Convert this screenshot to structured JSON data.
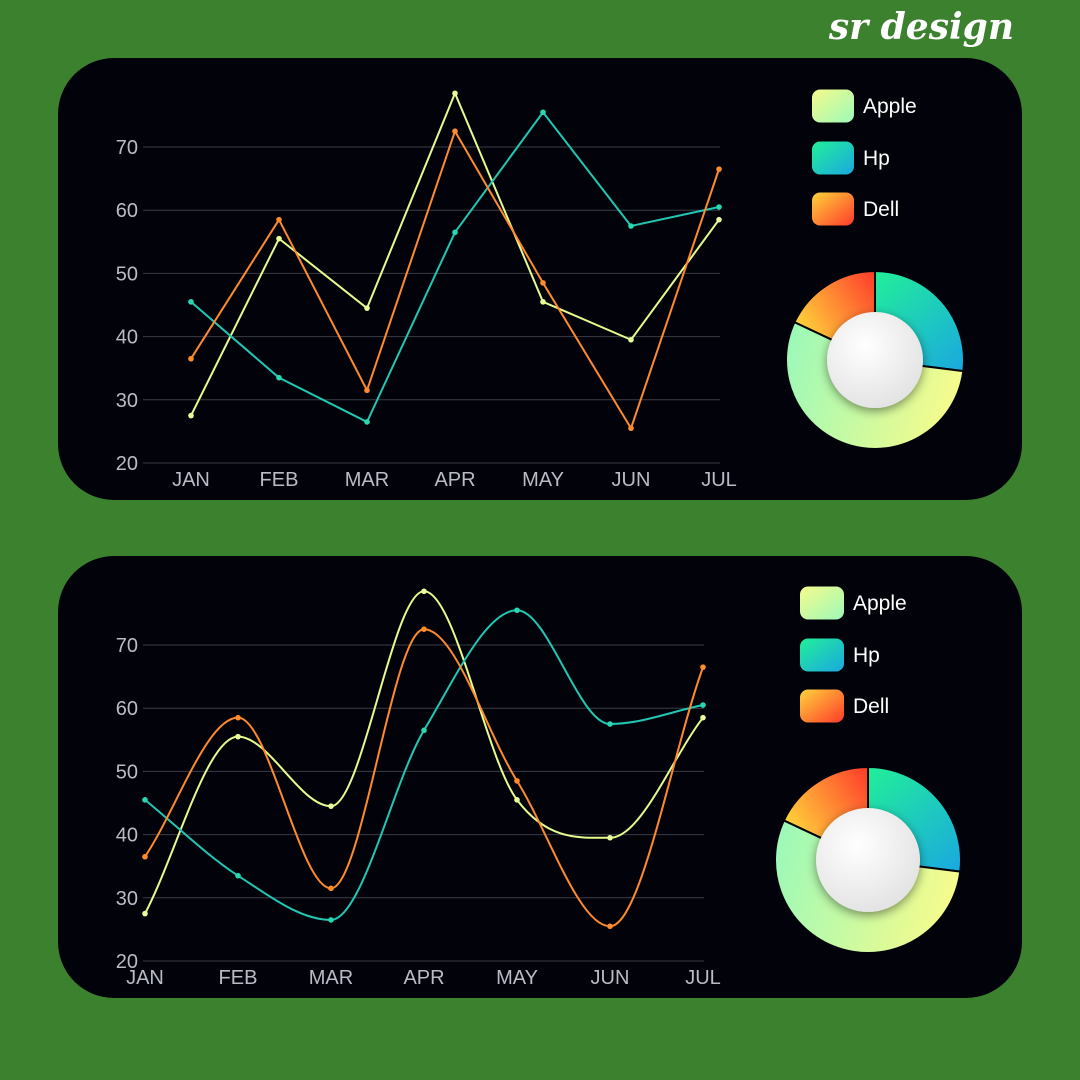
{
  "brand": "sr design",
  "colors": {
    "background": "#3c812e",
    "panel": "#02030a",
    "grid": "#3a3d48",
    "tick_text": "#b9bcc6",
    "donut_center": "#f4f4f4"
  },
  "series_styles": {
    "Apple": {
      "stroke": "#e5fb8e",
      "dot": "#e7fc9a",
      "swatch_from": "#f6fb8c",
      "swatch_to": "#9cf9b8"
    },
    "Hp": {
      "stroke": "#22c7b4",
      "dot": "#27d9b0",
      "swatch_from": "#22ef98",
      "swatch_to": "#1aa8e0"
    },
    "Dell": {
      "stroke": "#ff8a2e",
      "dot": "#ff8c2b",
      "swatch_from": "#ffd43a",
      "swatch_to": "#ff3a2b"
    }
  },
  "chart_data": [
    {
      "type": "line",
      "curve": "straight",
      "categories": [
        "JAN",
        "FEB",
        "MAR",
        "APR",
        "MAY",
        "JUN",
        "JUL"
      ],
      "yticks": [
        20,
        30,
        40,
        50,
        60,
        70
      ],
      "ylim": [
        20,
        80
      ],
      "grid": true,
      "legend": "top-right",
      "series": [
        {
          "name": "Apple",
          "values": [
            27.5,
            55.5,
            44.5,
            78.5,
            45.5,
            39.5,
            58.5
          ]
        },
        {
          "name": "Hp",
          "values": [
            45.5,
            33.5,
            26.5,
            56.5,
            75.5,
            57.5,
            60.5
          ]
        },
        {
          "name": "Dell",
          "values": [
            36.5,
            58.5,
            31.5,
            72.5,
            48.5,
            25.5,
            66.5
          ]
        }
      ],
      "donut": [
        {
          "name": "Hp",
          "value": 27
        },
        {
          "name": "Apple",
          "value": 55
        },
        {
          "name": "Dell",
          "value": 18
        }
      ]
    },
    {
      "type": "line",
      "curve": "smooth",
      "categories": [
        "JAN",
        "FEB",
        "MAR",
        "APR",
        "MAY",
        "JUN",
        "JUL"
      ],
      "yticks": [
        20,
        30,
        40,
        50,
        60,
        70
      ],
      "ylim": [
        20,
        80
      ],
      "grid": true,
      "legend": "top-right",
      "series": [
        {
          "name": "Apple",
          "values": [
            27.5,
            55.5,
            44.5,
            78.5,
            45.5,
            39.5,
            58.5
          ]
        },
        {
          "name": "Hp",
          "values": [
            45.5,
            33.5,
            26.5,
            56.5,
            75.5,
            57.5,
            60.5
          ]
        },
        {
          "name": "Dell",
          "values": [
            36.5,
            58.5,
            31.5,
            72.5,
            48.5,
            25.5,
            66.5
          ]
        }
      ],
      "donut": [
        {
          "name": "Hp",
          "value": 27
        },
        {
          "name": "Apple",
          "value": 55
        },
        {
          "name": "Dell",
          "value": 18
        }
      ]
    }
  ]
}
